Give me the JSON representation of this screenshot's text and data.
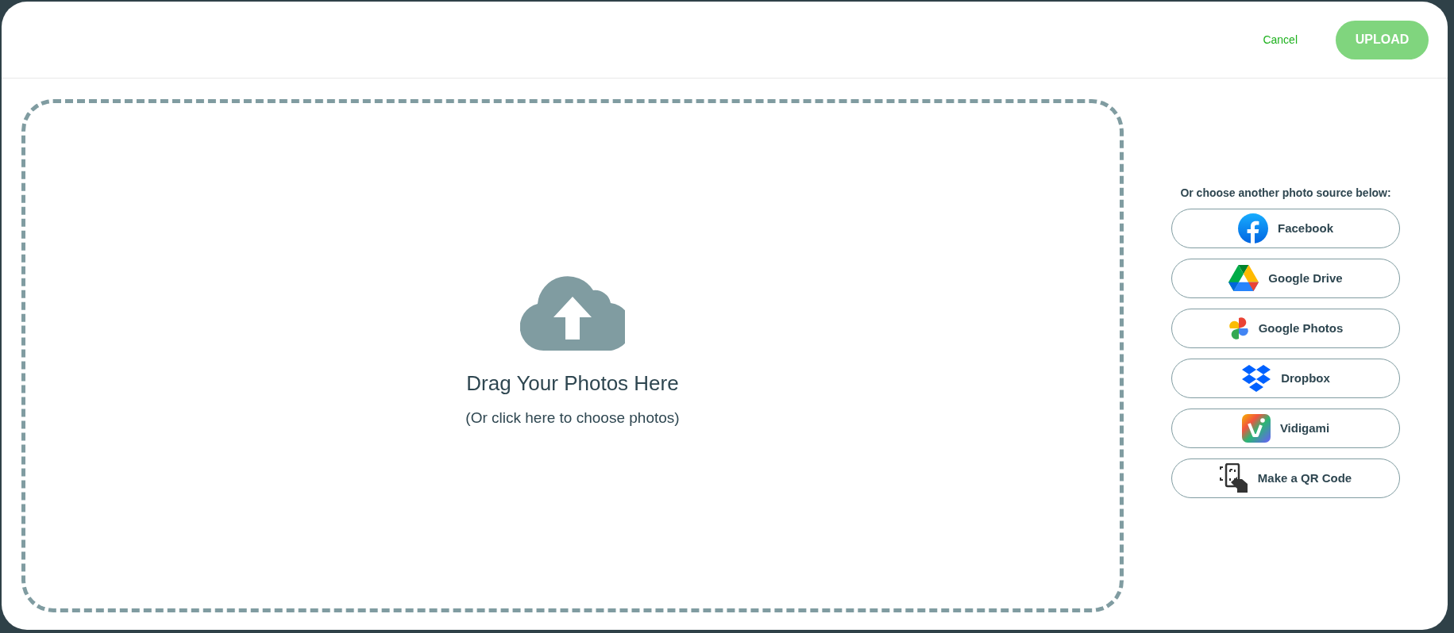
{
  "header": {
    "cancel": "Cancel",
    "upload": {
      "label": "UPLOAD",
      "disabled": true
    }
  },
  "dropzone": {
    "title": "Drag Your Photos Here",
    "subtitle": "(Or click here to choose photos)"
  },
  "sources_heading": "Or choose another photo source below:",
  "sources": [
    {
      "kind": "facebook",
      "label": "Facebook"
    },
    {
      "kind": "drive",
      "label": "Google Drive"
    },
    {
      "kind": "photos",
      "label": "Google Photos"
    },
    {
      "kind": "dropbox",
      "label": "Dropbox"
    },
    {
      "kind": "vidigami",
      "label": "Vidigami"
    },
    {
      "kind": "qr",
      "label": "Make a QR Code"
    }
  ]
}
